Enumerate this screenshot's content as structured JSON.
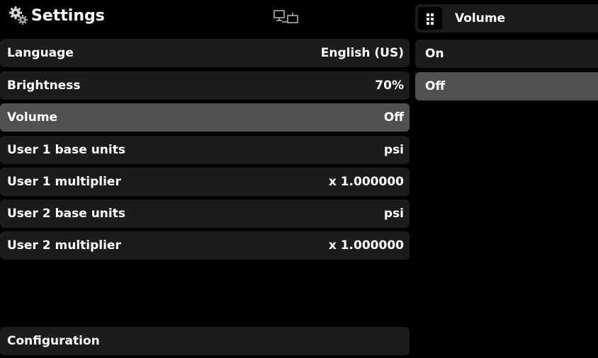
{
  "header": {
    "title": "Settings",
    "icon": "gears-icon",
    "status_icon": "network-icon"
  },
  "menu": {
    "items": [
      {
        "label": "Language",
        "value": "English (US)",
        "selected": false
      },
      {
        "label": "Brightness",
        "value": "70%",
        "selected": false
      },
      {
        "label": "Volume",
        "value": "Off",
        "selected": true
      },
      {
        "label": "User 1 base units",
        "value": "psi",
        "selected": false
      },
      {
        "label": "User 1 multiplier",
        "value": "x 1.000000",
        "selected": false
      },
      {
        "label": "User 2 base units",
        "value": "psi",
        "selected": false
      },
      {
        "label": "User 2 multiplier",
        "value": "x 1.000000",
        "selected": false
      }
    ],
    "footer_label": "Configuration"
  },
  "submenu": {
    "title": "Volume",
    "icon": "grid-icon",
    "options": [
      {
        "label": "On",
        "selected": false
      },
      {
        "label": "Off",
        "selected": true
      }
    ]
  },
  "colors": {
    "background": "#000000",
    "row": "#1c1c1c",
    "selected_row": "#505050",
    "text": "#ffffff"
  }
}
